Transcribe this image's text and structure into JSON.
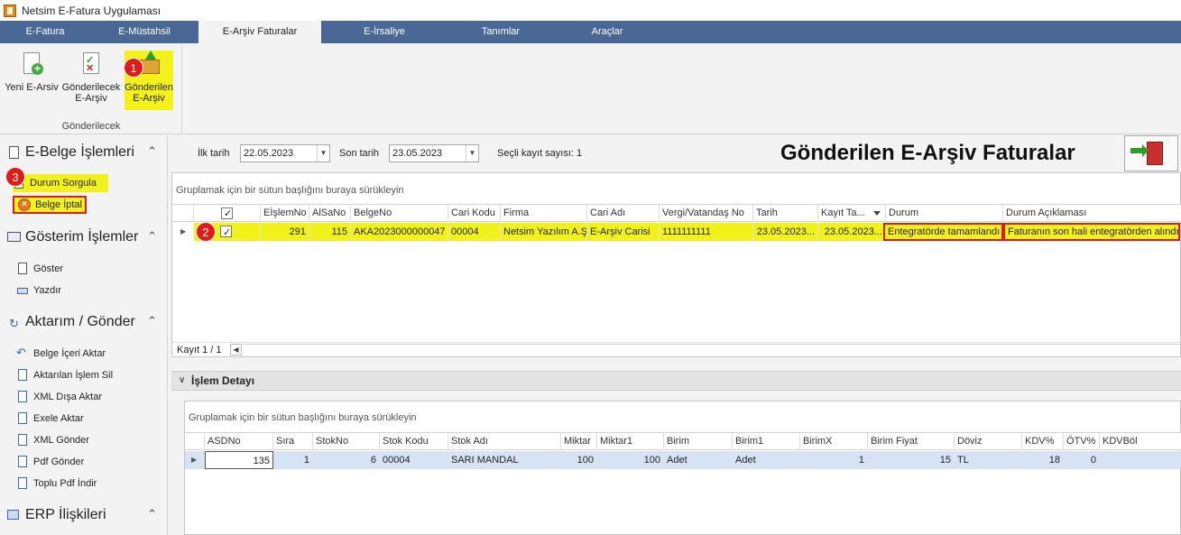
{
  "window": {
    "title": "Netsim E-Fatura Uygulaması"
  },
  "menu": {
    "tabs": [
      {
        "label": "E-Fatura"
      },
      {
        "label": "E-Müstahsil"
      },
      {
        "label": "E-Arşiv Faturalar"
      },
      {
        "label": "E-İrsaliye"
      },
      {
        "label": "Tanımlar"
      },
      {
        "label": "Araçlar"
      }
    ],
    "active_tab": "E-Arşiv Faturalar"
  },
  "ribbon": {
    "group_label": "Gönderilecek",
    "buttons": [
      {
        "label": "Yeni E-Arsiv",
        "icon": "new-document-icon"
      },
      {
        "label_line1": "Gönderilecek",
        "label_line2": "E-Arşiv",
        "icon": "checklist-document-icon"
      },
      {
        "label_line1": "Gönderilen",
        "label_line2": "E-Arşiv",
        "icon": "folder-upload-icon"
      }
    ]
  },
  "badges": {
    "b1": "1",
    "b2": "2",
    "b3": "3"
  },
  "sidebar": {
    "sections": [
      {
        "title": "E-Belge İşlemleri",
        "icon": "clipboard-icon",
        "items": [
          {
            "label": "Durum Sorgula",
            "icon": "document-query-icon"
          },
          {
            "label": "Belge İptal",
            "icon": "cancel-icon"
          }
        ]
      },
      {
        "title": "Gösterim İşlemler",
        "icon": "monitor-icon",
        "items": [
          {
            "label": "Göster",
            "icon": "view-list-icon"
          },
          {
            "label": "Yazdır",
            "icon": "printer-icon"
          }
        ]
      },
      {
        "title": "Aktarım / Gönder",
        "icon": "transfer-icon",
        "items": [
          {
            "label": "Belge İçeri Aktar",
            "icon": "import-arrow-icon"
          },
          {
            "label": "Aktarılan İşlem Sil",
            "icon": "delete-document-icon"
          },
          {
            "label": "XML Dışa Aktar",
            "icon": "xml-icon"
          },
          {
            "label": "Exele Aktar",
            "icon": "excel-icon"
          },
          {
            "label": "XML Gönder",
            "icon": "xml-send-icon"
          },
          {
            "label": "Pdf Gönder",
            "icon": "pdf-icon"
          },
          {
            "label": "Toplu Pdf İndir",
            "icon": "pdf-download-icon"
          }
        ]
      },
      {
        "title": "ERP İlişkileri",
        "icon": "erp-icon",
        "items": []
      }
    ]
  },
  "filters": {
    "start_label": "İlk tarih",
    "start_value": "22.05.2023",
    "end_label": "Son tarih",
    "end_value": "23.05.2023",
    "selected_count": "Seçli kayıt sayısı: 1"
  },
  "heading": "Gönderilen E-Arşiv Faturalar",
  "grid": {
    "group_hint": "Gruplamak için bir sütun başlığını buraya sürükleyin",
    "columns": [
      "EİşlemNo",
      "AlSaNo",
      "BelgeNo",
      "Cari Kodu",
      "Firma",
      "Cari Adı",
      "Vergi/Vatandaş No",
      "Tarih",
      "Kayıt Ta...",
      "Durum",
      "Durum Açıklaması"
    ],
    "rows": [
      {
        "checked": true,
        "cells": [
          "291",
          "115",
          "AKA2023000000047",
          "00004",
          "Netsim Yazılım A.Ş",
          "E-Arşiv Carisi",
          "1111111111",
          "23.05.2023...",
          "23.05.2023...",
          "Entegratörde tamamlandı",
          "Faturanın son hali entegratörden alındı"
        ]
      }
    ],
    "record_text": "Kayıt 1 / 1"
  },
  "detail": {
    "title": "İşlem Detayı",
    "group_hint": "Gruplamak için bir sütun başlığını buraya sürükleyin",
    "columns": [
      "ASDNo",
      "Sıra",
      "StokNo",
      "Stok Kodu",
      "Stok Adı",
      "Miktar",
      "Miktar1",
      "Birim",
      "Birim1",
      "BirimX",
      "Birim Fiyat",
      "Döviz",
      "KDV%",
      "ÖTV%",
      "KDVBöl"
    ],
    "rows": [
      {
        "cells": [
          "135",
          "1",
          "6",
          "00004",
          "SARI MANDAL",
          "100",
          "100",
          "Adet",
          "Adet",
          "1",
          "15",
          "TL",
          "18",
          "0",
          ""
        ]
      }
    ]
  },
  "colors": {
    "highlight": "#f2f21a",
    "annotation_red": "#e01b1b",
    "menubar": "#4a6895",
    "selected_row": "#d6e3f5"
  }
}
